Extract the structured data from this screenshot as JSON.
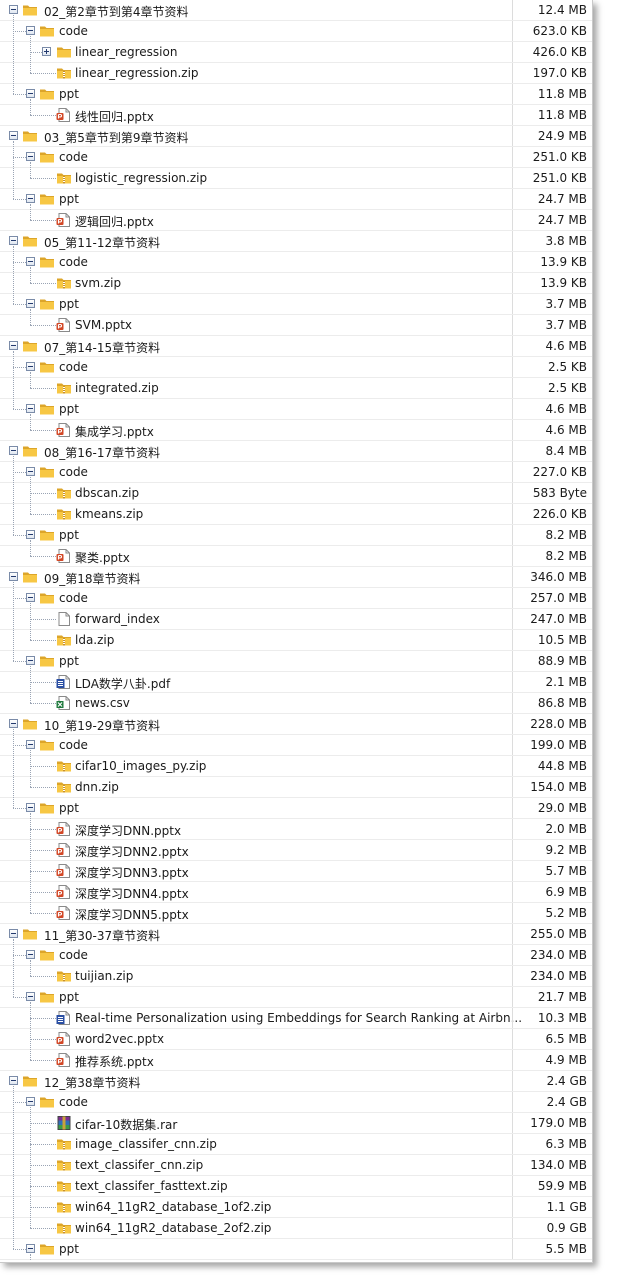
{
  "rows": [
    {
      "d": 0,
      "t": "folder",
      "n": "02_第2章节到第4章节资料",
      "s": "12.4 MB",
      "open": true
    },
    {
      "d": 1,
      "t": "folder",
      "n": "code",
      "s": "623.0 KB",
      "open": true
    },
    {
      "d": 2,
      "t": "folder",
      "n": "linear_regression",
      "s": "426.0 KB",
      "open": false
    },
    {
      "d": 2,
      "t": "zip",
      "n": "linear_regression.zip",
      "s": "197.0 KB"
    },
    {
      "d": 1,
      "t": "folder",
      "n": "ppt",
      "s": "11.8 MB",
      "open": true
    },
    {
      "d": 2,
      "t": "pptx",
      "n": "线性回归.pptx",
      "s": "11.8 MB"
    },
    {
      "d": 0,
      "t": "folder",
      "n": "03_第5章节到第9章节资料",
      "s": "24.9 MB",
      "open": true
    },
    {
      "d": 1,
      "t": "folder",
      "n": "code",
      "s": "251.0 KB",
      "open": true
    },
    {
      "d": 2,
      "t": "zip",
      "n": "logistic_regression.zip",
      "s": "251.0 KB"
    },
    {
      "d": 1,
      "t": "folder",
      "n": "ppt",
      "s": "24.7 MB",
      "open": true
    },
    {
      "d": 2,
      "t": "pptx",
      "n": "逻辑回归.pptx",
      "s": "24.7 MB"
    },
    {
      "d": 0,
      "t": "folder",
      "n": "05_第11-12章节资料",
      "s": "3.8 MB",
      "open": true
    },
    {
      "d": 1,
      "t": "folder",
      "n": "code",
      "s": "13.9 KB",
      "open": true
    },
    {
      "d": 2,
      "t": "zip",
      "n": "svm.zip",
      "s": "13.9 KB"
    },
    {
      "d": 1,
      "t": "folder",
      "n": "ppt",
      "s": "3.7 MB",
      "open": true
    },
    {
      "d": 2,
      "t": "pptx",
      "n": "SVM.pptx",
      "s": "3.7 MB"
    },
    {
      "d": 0,
      "t": "folder",
      "n": "07_第14-15章节资料",
      "s": "4.6 MB",
      "open": true
    },
    {
      "d": 1,
      "t": "folder",
      "n": "code",
      "s": "2.5 KB",
      "open": true
    },
    {
      "d": 2,
      "t": "zip",
      "n": "integrated.zip",
      "s": "2.5 KB"
    },
    {
      "d": 1,
      "t": "folder",
      "n": "ppt",
      "s": "4.6 MB",
      "open": true
    },
    {
      "d": 2,
      "t": "pptx",
      "n": "集成学习.pptx",
      "s": "4.6 MB"
    },
    {
      "d": 0,
      "t": "folder",
      "n": "08_第16-17章节资料",
      "s": "8.4 MB",
      "open": true
    },
    {
      "d": 1,
      "t": "folder",
      "n": "code",
      "s": "227.0 KB",
      "open": true
    },
    {
      "d": 2,
      "t": "zip",
      "n": "dbscan.zip",
      "s": "583 Byte"
    },
    {
      "d": 2,
      "t": "zip",
      "n": "kmeans.zip",
      "s": "226.0 KB"
    },
    {
      "d": 1,
      "t": "folder",
      "n": "ppt",
      "s": "8.2 MB",
      "open": true
    },
    {
      "d": 2,
      "t": "pptx",
      "n": "聚类.pptx",
      "s": "8.2 MB"
    },
    {
      "d": 0,
      "t": "folder",
      "n": "09_第18章节资料",
      "s": "346.0 MB",
      "open": true
    },
    {
      "d": 1,
      "t": "folder",
      "n": "code",
      "s": "257.0 MB",
      "open": true
    },
    {
      "d": 2,
      "t": "file",
      "n": "forward_index",
      "s": "247.0 MB"
    },
    {
      "d": 2,
      "t": "zip",
      "n": "lda.zip",
      "s": "10.5 MB"
    },
    {
      "d": 1,
      "t": "folder",
      "n": "ppt",
      "s": "88.9 MB",
      "open": true
    },
    {
      "d": 2,
      "t": "pdf",
      "n": "LDA数学八卦.pdf",
      "s": "2.1 MB"
    },
    {
      "d": 2,
      "t": "csv",
      "n": "news.csv",
      "s": "86.8 MB"
    },
    {
      "d": 0,
      "t": "folder",
      "n": "10_第19-29章节资料",
      "s": "228.0 MB",
      "open": true
    },
    {
      "d": 1,
      "t": "folder",
      "n": "code",
      "s": "199.0 MB",
      "open": true
    },
    {
      "d": 2,
      "t": "zip",
      "n": "cifar10_images_py.zip",
      "s": "44.8 MB"
    },
    {
      "d": 2,
      "t": "zip",
      "n": "dnn.zip",
      "s": "154.0 MB"
    },
    {
      "d": 1,
      "t": "folder",
      "n": "ppt",
      "s": "29.0 MB",
      "open": true
    },
    {
      "d": 2,
      "t": "pptx",
      "n": "深度学习DNN.pptx",
      "s": "2.0 MB"
    },
    {
      "d": 2,
      "t": "pptx",
      "n": "深度学习DNN2.pptx",
      "s": "9.2 MB"
    },
    {
      "d": 2,
      "t": "pptx",
      "n": "深度学习DNN3.pptx",
      "s": "5.7 MB"
    },
    {
      "d": 2,
      "t": "pptx",
      "n": "深度学习DNN4.pptx",
      "s": "6.9 MB"
    },
    {
      "d": 2,
      "t": "pptx",
      "n": "深度学习DNN5.pptx",
      "s": "5.2 MB"
    },
    {
      "d": 0,
      "t": "folder",
      "n": "11_第30-37章节资料",
      "s": "255.0 MB",
      "open": true
    },
    {
      "d": 1,
      "t": "folder",
      "n": "code",
      "s": "234.0 MB",
      "open": true
    },
    {
      "d": 2,
      "t": "zip",
      "n": "tuijian.zip",
      "s": "234.0 MB"
    },
    {
      "d": 1,
      "t": "folder",
      "n": "ppt",
      "s": "21.7 MB",
      "open": true
    },
    {
      "d": 2,
      "t": "pdf",
      "n": "Real-time Personalization using Embeddings for Search Ranking at Airbn...",
      "s": "10.3 MB"
    },
    {
      "d": 2,
      "t": "pptx",
      "n": "word2vec.pptx",
      "s": "6.5 MB"
    },
    {
      "d": 2,
      "t": "pptx",
      "n": "推荐系统.pptx",
      "s": "4.9 MB"
    },
    {
      "d": 0,
      "t": "folder",
      "n": "12_第38章节资料",
      "s": "2.4 GB",
      "open": true
    },
    {
      "d": 1,
      "t": "folder",
      "n": "code",
      "s": "2.4 GB",
      "open": true
    },
    {
      "d": 2,
      "t": "rar",
      "n": "cifar-10数据集.rar",
      "s": "179.0 MB"
    },
    {
      "d": 2,
      "t": "zip",
      "n": "image_classifer_cnn.zip",
      "s": "6.3 MB"
    },
    {
      "d": 2,
      "t": "zip",
      "n": "text_classifer_cnn.zip",
      "s": "134.0 MB"
    },
    {
      "d": 2,
      "t": "zip",
      "n": "text_classifer_fasttext.zip",
      "s": "59.9 MB"
    },
    {
      "d": 2,
      "t": "zip",
      "n": "win64_11gR2_database_1of2.zip",
      "s": "1.1 GB"
    },
    {
      "d": 2,
      "t": "zip",
      "n": "win64_11gR2_database_2of2.zip",
      "s": "0.9 GB"
    },
    {
      "d": 1,
      "t": "folder",
      "n": "ppt",
      "s": "5.5 MB",
      "open": true
    }
  ],
  "colors": {
    "folder": "#f7c744",
    "folder_dark": "#dca52a",
    "pptx": "#d24726",
    "pdf": "#2b4fa3",
    "csv": "#1f7a3d",
    "zip_band": "#c8902a"
  }
}
